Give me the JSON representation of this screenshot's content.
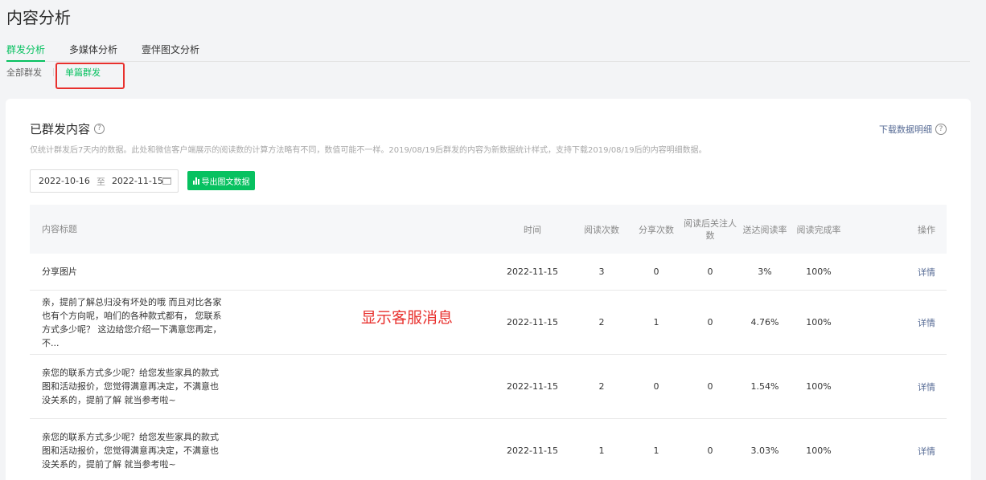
{
  "page": {
    "title": "内容分析"
  },
  "tabs": [
    "群发分析",
    "多媒体分析",
    "壹伴图文分析"
  ],
  "subtabs": [
    "全部群发",
    "单篇群发"
  ],
  "card": {
    "title": "已群发内容",
    "help_icon": "?",
    "description": "仅统计群发后7天内的数据。此处和微信客户端展示的阅读数的计算方法略有不同，数值可能不一样。2019/08/19后群发的内容为新数据统计样式，支持下载2019/08/19后的内容明细数据。",
    "download_label": "下载数据明细",
    "date_start": "2022-10-16",
    "date_sep": "至",
    "date_end": "2022-11-15",
    "export_label": "导出图文数据"
  },
  "table": {
    "headers": {
      "title": "内容标题",
      "time": "时间",
      "read": "阅读次数",
      "share": "分享次数",
      "follow": "阅读后关注人数",
      "rate": "送达阅读率",
      "done": "阅读完成率",
      "op": "操作"
    },
    "rows": [
      {
        "title": "分享图片",
        "time": "2022-11-15",
        "read": "3",
        "share": "0",
        "follow": "0",
        "rate": "3%",
        "done": "100%",
        "op": "详情"
      },
      {
        "title": "亲，提前了解总归没有坏处的哦 而且对比各家也有个方向呢，咱们的各种款式都有， 您联系方式多少呢？ 这边给您介绍一下满意您再定，不...",
        "time": "2022-11-15",
        "read": "2",
        "share": "1",
        "follow": "0",
        "rate": "4.76%",
        "done": "100%",
        "op": "详情"
      },
      {
        "title": "亲您的联系方式多少呢？给您发些家具的款式图和活动报价，您觉得满意再决定，不满意也没关系的，提前了解 就当参考啦~",
        "time": "2022-11-15",
        "read": "2",
        "share": "0",
        "follow": "0",
        "rate": "1.54%",
        "done": "100%",
        "op": "详情"
      },
      {
        "title": "亲您的联系方式多少呢？给您发些家具的款式图和活动报价，您觉得满意再决定，不满意也没关系的，提前了解 就当参考啦~",
        "time": "2022-11-15",
        "read": "1",
        "share": "1",
        "follow": "0",
        "rate": "3.03%",
        "done": "100%",
        "op": "详情"
      }
    ]
  },
  "annotation": "显示客服消息",
  "colors": {
    "accent": "#07c160",
    "link": "#576b95",
    "annotation": "#e8302d"
  }
}
